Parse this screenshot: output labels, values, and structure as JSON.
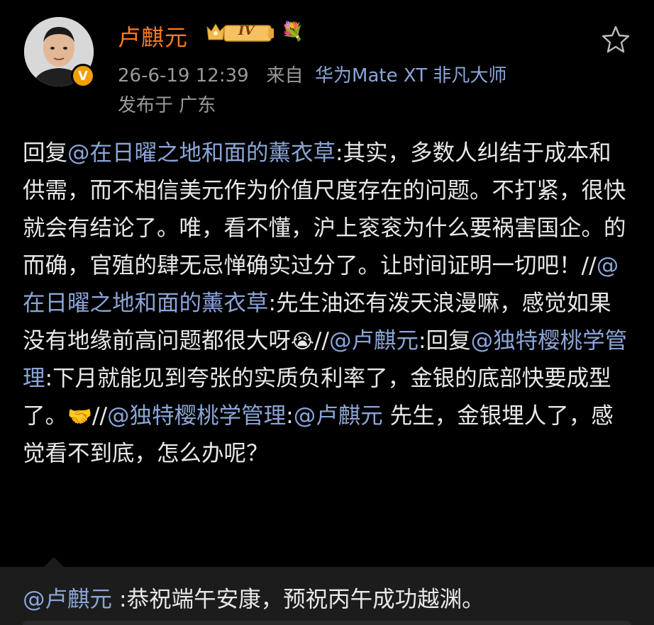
{
  "user": {
    "name": "卢麒元",
    "level_badge": "IV",
    "verified_badge": "V"
  },
  "meta": {
    "timestamp": "26-6-19 12:39",
    "from_label": "来自",
    "device": "华为Mate XT 非凡大师",
    "location": "发布于 广东"
  },
  "post": {
    "segments": [
      {
        "t": "text",
        "v": "回复"
      },
      {
        "t": "mention",
        "v": "@在日曜之地和面的薰衣草"
      },
      {
        "t": "text",
        "v": ":其实，多数人纠结于成本和供需，而不相信美元作为价值尺度存在的问题。不打紧，很快就会有结论了。唯，看不懂，沪上衮衮为什么要祸害国企。的而确，官殖的肆无忌惮确实过分了。让时间证明一切吧！//"
      },
      {
        "t": "mention",
        "v": "@在日曜之地和面的薰衣草"
      },
      {
        "t": "text",
        "v": ":先生油还有泼天浪漫嘛，感觉如果没有地缘前高问题都很大呀"
      },
      {
        "t": "emoji",
        "v": "😭"
      },
      {
        "t": "text",
        "v": "//"
      },
      {
        "t": "mention",
        "v": "@卢麒元"
      },
      {
        "t": "text",
        "v": ":回复"
      },
      {
        "t": "mention",
        "v": "@独特樱桃学管理"
      },
      {
        "t": "text",
        "v": ":下月就能见到夸张的实质负利率了，金银的底部快要成型了。"
      },
      {
        "t": "emoji",
        "v": "🤝"
      },
      {
        "t": "text",
        "v": "//"
      },
      {
        "t": "mention",
        "v": "@独特樱桃学管理"
      },
      {
        "t": "text",
        "v": ":"
      },
      {
        "t": "mention",
        "v": "@卢麒元"
      },
      {
        "t": "text",
        "v": " 先生，金银埋人了，感觉看不到底，怎么办呢？"
      }
    ]
  },
  "quote": {
    "mention": "@卢麒元",
    "text": " :恭祝端午安康，预祝丙午成功越渊。"
  },
  "colors": {
    "background": "#000000",
    "username": "#ff7a1a",
    "mention": "#8ba5d8",
    "meta": "#9a9a9a",
    "text": "#e8e8e8"
  },
  "icons": [
    "avatar",
    "verified-badge-icon",
    "level-crown-badge",
    "flower-icon",
    "favorite-star-icon"
  ]
}
